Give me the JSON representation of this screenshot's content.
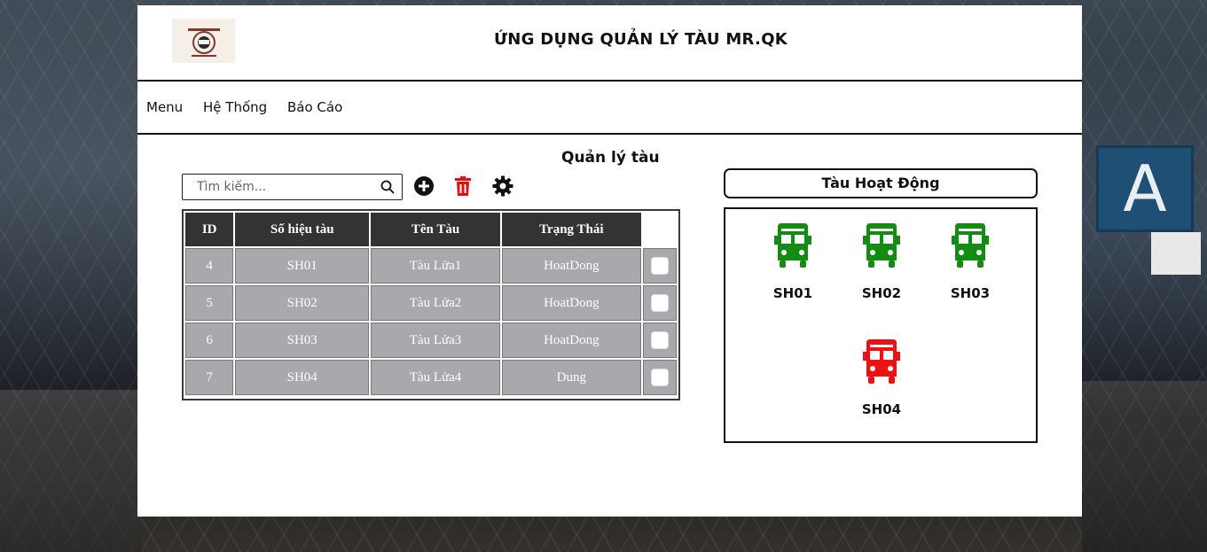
{
  "header": {
    "title": "ỨNG DỤNG QUẢN LÝ TÀU MR.QK"
  },
  "menu": {
    "items": [
      "Menu",
      "Hệ Thống",
      "Báo Cáo"
    ]
  },
  "main": {
    "title": "Quản lý tàu",
    "search_placeholder": "Tìm kiếm...",
    "toolbar": {
      "icons": [
        "add-icon",
        "trash-icon",
        "settings-icon"
      ],
      "trash_color": "#e01010"
    },
    "table": {
      "columns": [
        "ID",
        "Số hiệu tàu",
        "Tên Tàu",
        "Trạng Thái"
      ],
      "rows": [
        [
          "4",
          "SH01",
          "Tàu Lửa1",
          "HoatDong"
        ],
        [
          "5",
          "SH02",
          "Tàu Lửa2",
          "HoatDong"
        ],
        [
          "6",
          "SH03",
          "Tàu Lửa3",
          "HoatDong"
        ],
        [
          "7",
          "SH04",
          "Tàu Lửa4",
          "Dung"
        ]
      ]
    }
  },
  "active_panel": {
    "title": "Tàu Hoạt Động",
    "trains": [
      {
        "label": "SH01",
        "status": "active",
        "color": "#148c14"
      },
      {
        "label": "SH02",
        "status": "active",
        "color": "#148c14"
      },
      {
        "label": "SH03",
        "status": "active",
        "color": "#148c14"
      },
      {
        "label": "SH04",
        "status": "stopped",
        "color": "#ee1111"
      }
    ]
  },
  "background": {
    "sign_letter": "A"
  }
}
